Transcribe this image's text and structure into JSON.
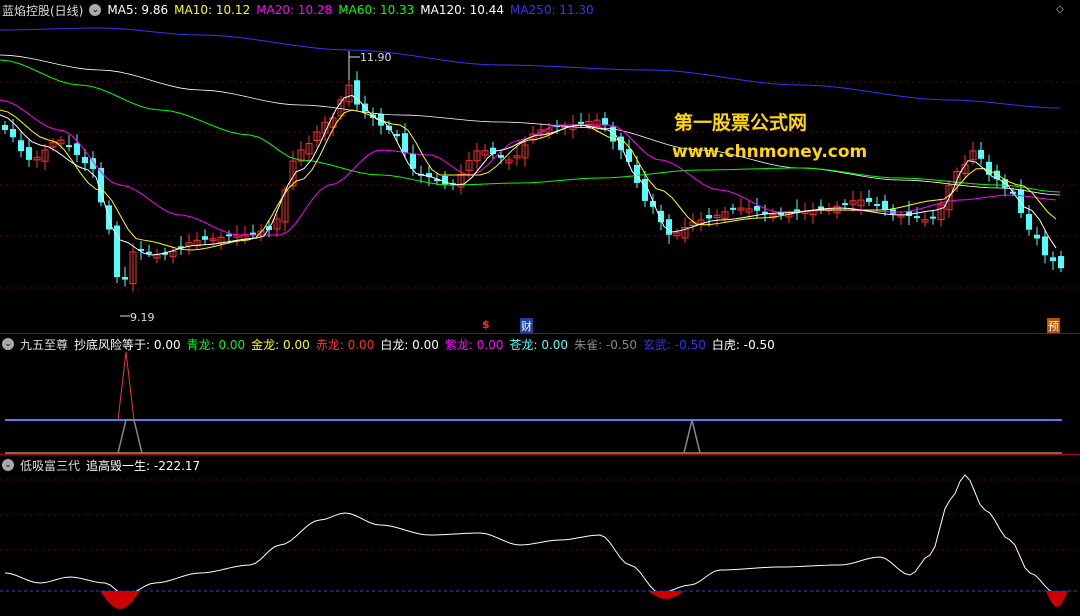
{
  "main": {
    "title": "蓝焰控股(日线)",
    "ma": [
      {
        "label": "MA5: 9.86",
        "color": "#ffffff"
      },
      {
        "label": "MA10: 10.12",
        "color": "#ffff00"
      },
      {
        "label": "MA20: 10.28",
        "color": "#ff00ff"
      },
      {
        "label": "MA60: 10.33",
        "color": "#00ff00"
      },
      {
        "label": "MA120: 10.44",
        "color": "#ffffff"
      },
      {
        "label": "MA250: 11.30",
        "color": "#3333ff"
      }
    ],
    "high_label": "11.90",
    "low_label": "9.19",
    "markers": [
      {
        "text": "$",
        "color": "#ff3030"
      },
      {
        "text": "财",
        "color": "#ffffff"
      },
      {
        "text": "预",
        "color": "#ffffff"
      }
    ],
    "watermark_title": "第一股票公式网",
    "watermark_url": "www.chnmoney.com",
    "colors": {
      "up": "#ff3030",
      "down": "#54fcfc"
    }
  },
  "ind1": {
    "title": "九五至尊",
    "items": [
      {
        "label": "抄底风险等于: 0.00",
        "color": "#ffffff"
      },
      {
        "label": "青龙: 0.00",
        "color": "#00ff00"
      },
      {
        "label": "金龙: 0.00",
        "color": "#ffff00"
      },
      {
        "label": "赤龙: 0.00",
        "color": "#ff3030"
      },
      {
        "label": "白龙: 0.00",
        "color": "#ffffff"
      },
      {
        "label": "紫龙: 0.00",
        "color": "#ff00ff"
      },
      {
        "label": "苍龙: 0.00",
        "color": "#54fcfc"
      },
      {
        "label": "朱雀: -0.50",
        "color": "#888888"
      },
      {
        "label": "玄武: -0.50",
        "color": "#3333ff"
      },
      {
        "label": "白虎: -0.50",
        "color": "#ffffff"
      }
    ]
  },
  "ind2": {
    "title": "低吸富三代",
    "items": [
      {
        "label": "追高毁一生: -222.17",
        "color": "#ffffff"
      }
    ]
  }
}
